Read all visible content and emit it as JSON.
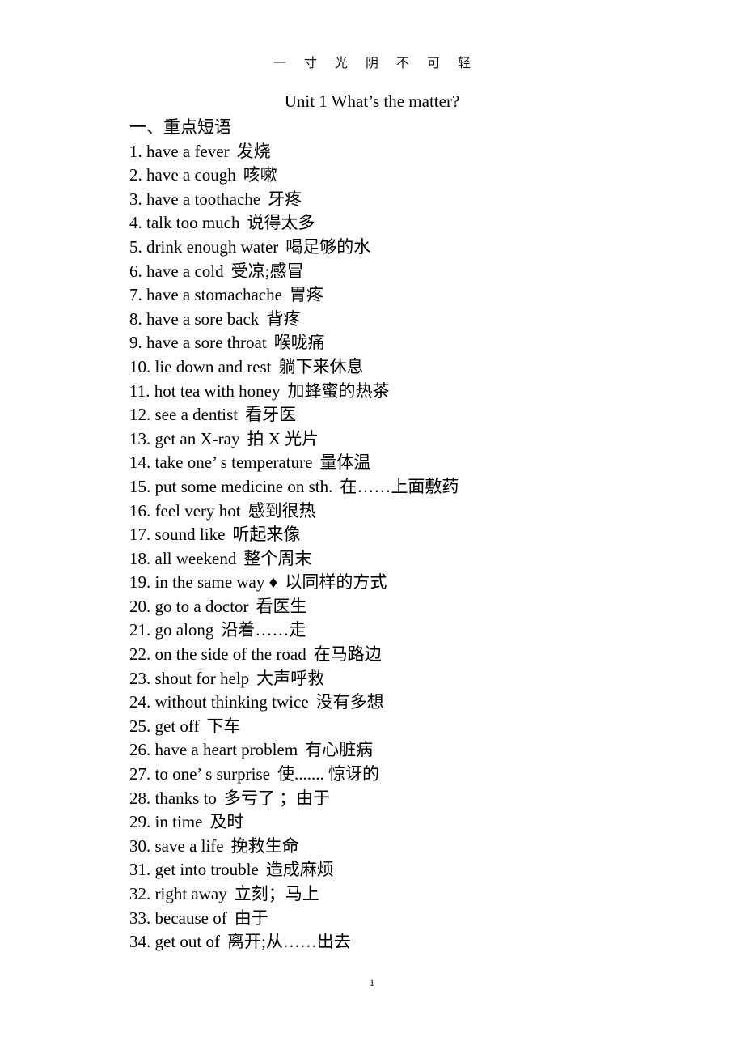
{
  "document": {
    "running_head": "一 寸 光 阴 不 可 轻",
    "title": "Unit 1 What’s the matter?",
    "section_heading": "一、重点短语",
    "page_number": "1"
  },
  "phrases": [
    {
      "num": "1.",
      "en": "have a fever",
      "cn": "发烧"
    },
    {
      "num": "2.",
      "en": "have a cough",
      "cn": "咳嗽"
    },
    {
      "num": "3.",
      "en": "have a toothache",
      "cn": "牙疼"
    },
    {
      "num": "4.",
      "en": "talk too much",
      "cn": "说得太多"
    },
    {
      "num": "5.",
      "en": "drink enough water",
      "cn": "喝足够的水"
    },
    {
      "num": "6.",
      "en": "have a cold",
      "cn": "受凉;感冒"
    },
    {
      "num": "7.",
      "en": "have a stomachache",
      "cn": "胃疼"
    },
    {
      "num": "8.",
      "en": "have a sore back",
      "cn": "背疼"
    },
    {
      "num": "9.",
      "en": "have a sore throat",
      "cn": "喉咙痛"
    },
    {
      "num": "10.",
      "en": "lie down and rest",
      "cn": "躺下来休息"
    },
    {
      "num": "11.",
      "en": "hot tea with honey",
      "cn": "加蜂蜜的热茶"
    },
    {
      "num": "12.",
      "en": "see a dentist",
      "cn": "看牙医"
    },
    {
      "num": "13.",
      "en": "get an X-ray",
      "cn": "拍 X 光片"
    },
    {
      "num": "14.",
      "en": "take one’ s temperature",
      "cn": "量体温"
    },
    {
      "num": "15.",
      "en": "put some medicine on sth.",
      "cn": "在……上面敷药"
    },
    {
      "num": "16.",
      "en": "feel very hot",
      "cn": "感到很热"
    },
    {
      "num": "17.",
      "en": "sound like",
      "cn": "听起来像"
    },
    {
      "num": "18.",
      "en": "all weekend",
      "cn": "整个周末"
    },
    {
      "num": "19.",
      "en": "in the same way ♦",
      "cn": "以同样的方式"
    },
    {
      "num": "20.",
      "en": "go to a doctor",
      "cn": "看医生"
    },
    {
      "num": "21.",
      "en": "go along",
      "cn": "沿着……走"
    },
    {
      "num": "22.",
      "en": "on the side of the road",
      "cn": "在马路边"
    },
    {
      "num": "23.",
      "en": "shout for help",
      "cn": "大声呼救"
    },
    {
      "num": "24.",
      "en": "without thinking twice",
      "cn": "没有多想"
    },
    {
      "num": "25.",
      "en": "get off",
      "cn": "下车"
    },
    {
      "num": "26.",
      "en": "have a heart problem",
      "cn": "有心脏病"
    },
    {
      "num": "27.",
      "en": "to one’ s surprise",
      "cn": "使....... 惊讶的"
    },
    {
      "num": "28.",
      "en": "thanks to",
      "cn": "多亏了 ；由于"
    },
    {
      "num": "29.",
      "en": "in time",
      "cn": "及时"
    },
    {
      "num": "30.",
      "en": "save a life",
      "cn": "挽救生命"
    },
    {
      "num": "31.",
      "en": "get into trouble",
      "cn": "造成麻烦"
    },
    {
      "num": "32.",
      "en": "right away",
      "cn": "立刻；马上"
    },
    {
      "num": "33.",
      "en": "because of",
      "cn": "由于"
    },
    {
      "num": "34.",
      "en": "get out of",
      "cn": "离开;从……出去"
    }
  ]
}
